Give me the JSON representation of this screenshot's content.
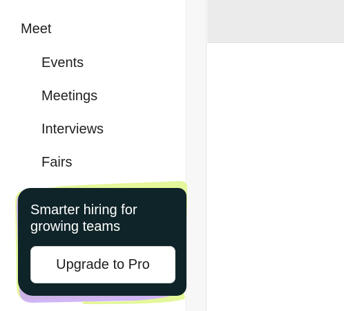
{
  "sidebar": {
    "section_label": "Meet",
    "items": [
      {
        "label": "Events"
      },
      {
        "label": "Meetings"
      },
      {
        "label": "Interviews"
      },
      {
        "label": "Fairs"
      }
    ],
    "promo": {
      "text": "Smarter hiring for growing teams",
      "button_label": "Upgrade to Pro",
      "colors": {
        "card": "#0f2428",
        "blob_purple": "#c9a8f5",
        "blob_lime": "#e4f79a"
      }
    }
  },
  "main": {
    "header_color": "#ebebeb"
  }
}
